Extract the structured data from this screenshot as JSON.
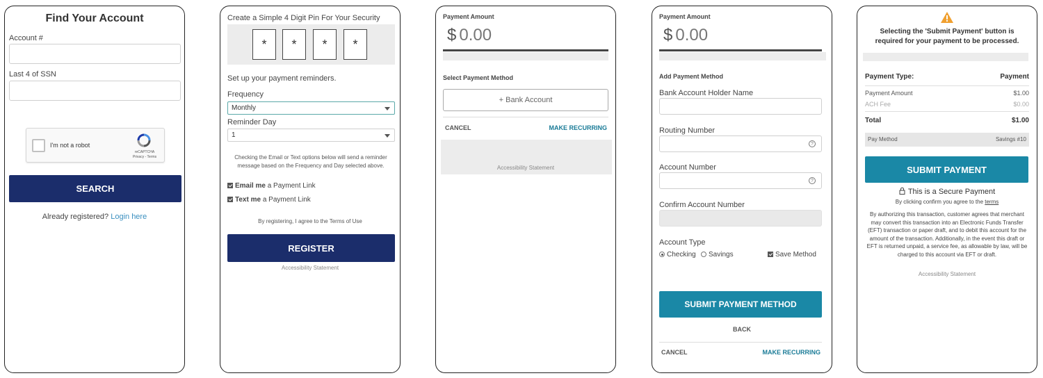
{
  "screen1": {
    "title": "Find Your Account",
    "account_label": "Account #",
    "ssn_label": "Last 4 of SSN",
    "recaptcha_label": "I'm not a robot",
    "recaptcha_brand": "reCAPTCHA",
    "recaptcha_links": "Privacy - Terms",
    "search_button": "SEARCH",
    "already_registered": "Already registered?",
    "login_link": "Login here"
  },
  "screen2": {
    "pin_title": "Create a Simple 4 Digit Pin For Your Security",
    "pin_chars": [
      "*",
      "*",
      "*",
      "*"
    ],
    "reminder_title": "Set up your payment reminders.",
    "frequency_label": "Frequency",
    "frequency_value": "Monthly",
    "reminder_day_label": "Reminder Day",
    "reminder_day_value": "1",
    "info_text": "Checking the Email or Text options below will send a reminder message based on the Frequency and Day selected above.",
    "email_bold": "Email me",
    "email_rest": "a Payment Link",
    "text_bold": "Text me",
    "text_rest": "a Payment Link",
    "terms_text": "By registering, I agree to the Terms of Use",
    "register_button": "REGISTER",
    "accessibility": "Accessibility Statement"
  },
  "screen3": {
    "amount_label": "Payment Amount",
    "currency": "$",
    "amount": "0.00",
    "method_label": "Select Payment Method",
    "bank_button": "+ Bank Account",
    "cancel": "CANCEL",
    "recurring": "MAKE RECURRING",
    "accessibility": "Accessibility Statement"
  },
  "screen4": {
    "amount_label": "Payment Amount",
    "currency": "$",
    "amount": "0.00",
    "add_method_label": "Add Payment Method",
    "holder_label": "Bank Account Holder Name",
    "routing_label": "Routing Number",
    "account_label": "Account Number",
    "confirm_label": "Confirm Account Number",
    "help_glyph": "?",
    "type_label": "Account Type",
    "checking": "Checking",
    "savings": "Savings",
    "save_method": "Save Method",
    "submit_button": "SUBMIT PAYMENT METHOD",
    "back": "BACK",
    "cancel": "CANCEL",
    "recurring": "MAKE RECURRING"
  },
  "screen5": {
    "warning_text": "Selecting the 'Submit Payment' button is required for your payment to be processed.",
    "type_label": "Payment Type:",
    "type_value": "Payment",
    "amount_label": "Payment Amount",
    "amount_value": "$1.00",
    "fee_label": "ACH Fee",
    "fee_value": "$0.00",
    "total_label": "Total",
    "total_value": "$1.00",
    "method_label": "Pay Method",
    "method_value": "Savings #10",
    "submit_button": "SUBMIT PAYMENT",
    "secure_text": "This is a Secure Payment",
    "confirm_prefix": "By clicking confirm you agree to the",
    "terms_link": "terms",
    "legal_text": "By authorizing this transaction, customer agrees that merchant may convert this transaction into an Electronic Funds Transfer (EFT) transaction or paper draft, and to debit this account for the amount of the transaction. Additionally, in the event this draft or EFT is returned unpaid, a service fee, as allowable by law, will be charged to this account via EFT or draft.",
    "accessibility": "Accessibility Statement"
  },
  "colors": {
    "navy": "#1b2d6b",
    "teal": "#1a88a6",
    "warning": "#f0a030"
  }
}
